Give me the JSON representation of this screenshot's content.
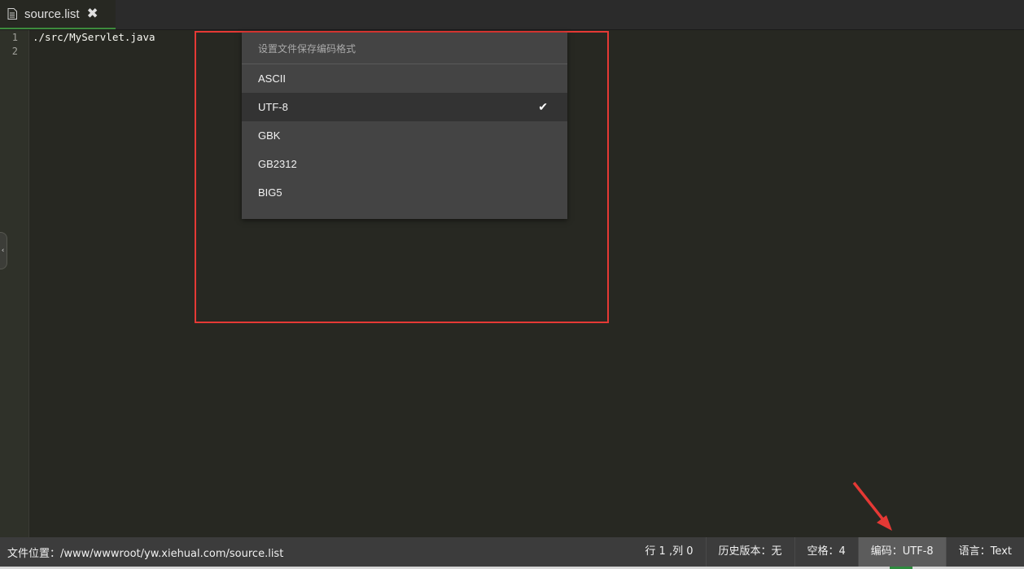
{
  "tab": {
    "label": "source.list",
    "close": "✖"
  },
  "editor": {
    "lines": [
      {
        "number": "1",
        "text": "./src/MyServlet.java"
      },
      {
        "number": "2",
        "text": ""
      }
    ]
  },
  "encoding_menu": {
    "header": "设置文件保存编码格式",
    "items": [
      {
        "label": "ASCII"
      },
      {
        "label": "UTF-8",
        "check": "✔"
      },
      {
        "label": "GBK"
      },
      {
        "label": "GB2312"
      },
      {
        "label": "BIG5"
      }
    ],
    "selected": "UTF-8"
  },
  "statusbar": {
    "path": "文件位置：/www/wwwroot/yw.xiehual.com/source.list",
    "cursor": "行 1 ,列 0",
    "history": "历史版本：无",
    "indent": "空格：4",
    "encoding": "编码：UTF-8",
    "language": "语言：Text"
  },
  "side_handle_glyph": "‹",
  "colors": {
    "highlight_box": "#e53935",
    "arrow": "#e53935",
    "tab_underline": "#3d8b3d",
    "editor_bg": "#272822"
  }
}
